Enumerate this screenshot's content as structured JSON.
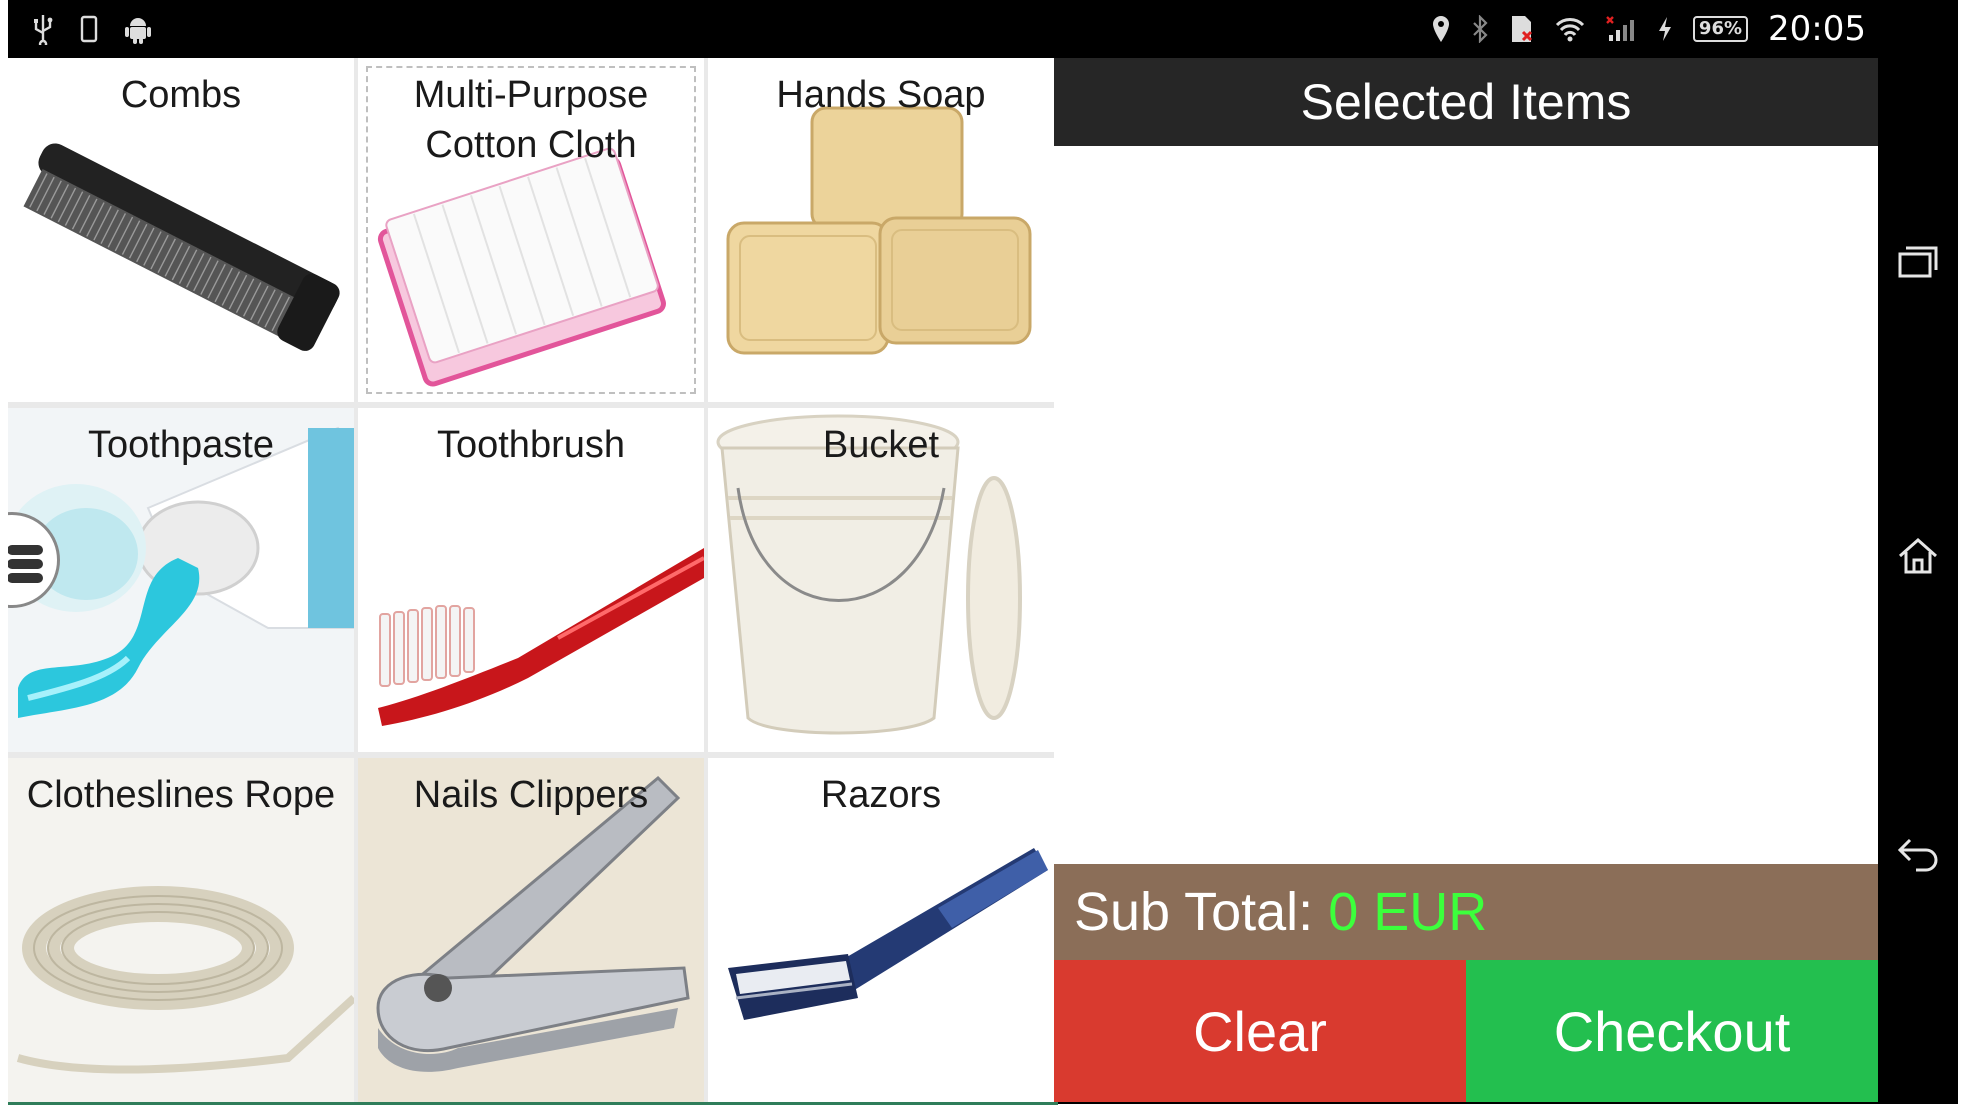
{
  "status_bar": {
    "left_icons": [
      "usb-icon",
      "phone-icon",
      "android-icon"
    ],
    "right_icons": [
      "location-icon",
      "bluetooth-icon",
      "sim-icon",
      "wifi-icon",
      "signal-icon",
      "charging-icon"
    ],
    "battery": "96%",
    "time": "20:05"
  },
  "products": [
    {
      "label": "Combs",
      "icon": "comb-image"
    },
    {
      "label": "Multi-Purpose\nCotton Cloth",
      "icon": "cotton-cloth-image"
    },
    {
      "label": "Hands Soap",
      "icon": "soap-image"
    },
    {
      "label": "Toothpaste",
      "icon": "toothpaste-image"
    },
    {
      "label": "Toothbrush",
      "icon": "toothbrush-image"
    },
    {
      "label": "Bucket",
      "icon": "bucket-image"
    },
    {
      "label": "Clotheslines Rope",
      "icon": "rope-image"
    },
    {
      "label": "Nails Clippers",
      "icon": "nail-clipper-image"
    },
    {
      "label": "Razors",
      "icon": "razor-image"
    }
  ],
  "panel": {
    "title": "Selected Items",
    "subtotal_label": "Sub Total:",
    "subtotal_value": "0 EUR",
    "clear_label": "Clear",
    "checkout_label": "Checkout"
  },
  "colors": {
    "header_bg": "#262626",
    "subtotal_bg": "#8b6e58",
    "subtotal_value": "#3cff3c",
    "clear_bg": "#d93a2f",
    "checkout_bg": "#23bf4f"
  },
  "nav_icons": [
    "recent-apps-icon",
    "home-icon",
    "back-icon"
  ]
}
